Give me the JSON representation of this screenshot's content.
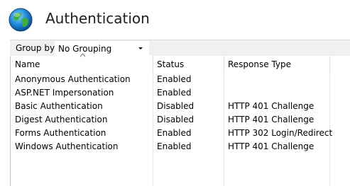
{
  "header": {
    "title": "Authentication",
    "icon": "globe-icon"
  },
  "toolbar": {
    "group_by_label": "Group by:",
    "group_by_value": "No Grouping"
  },
  "table": {
    "columns": [
      "Name",
      "Status",
      "Response Type"
    ],
    "rows": [
      {
        "name": "Anonymous Authentication",
        "status": "Enabled",
        "response": ""
      },
      {
        "name": "ASP.NET Impersonation",
        "status": "Enabled",
        "response": ""
      },
      {
        "name": "Basic Authentication",
        "status": "Disabled",
        "response": "HTTP 401 Challenge"
      },
      {
        "name": "Digest Authentication",
        "status": "Disabled",
        "response": "HTTP 401 Challenge"
      },
      {
        "name": "Forms Authentication",
        "status": "Enabled",
        "response": "HTTP 302 Login/Redirect"
      },
      {
        "name": "Windows Authentication",
        "status": "Enabled",
        "response": "HTTP 401 Challenge"
      }
    ]
  }
}
